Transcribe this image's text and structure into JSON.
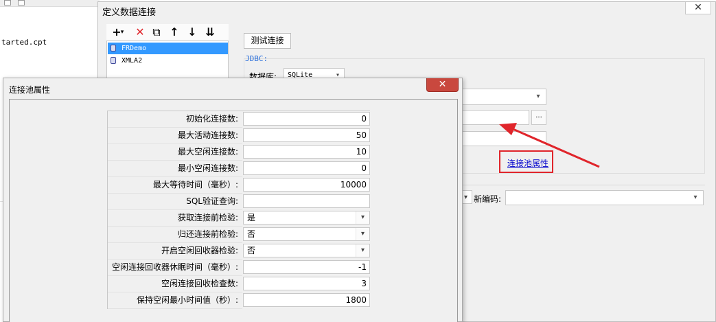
{
  "background": {
    "file_name": "tarted.cpt"
  },
  "main_dialog": {
    "title": "定义数据连接",
    "close_symbol": "✕",
    "toolbar": {
      "add": "+",
      "add_dropdown": "▾",
      "delete": "✕",
      "copy": "⧉",
      "up": "↑",
      "down": "↓",
      "sort": "⇊"
    },
    "connections": [
      {
        "name": "FRDemo",
        "selected": true
      },
      {
        "name": "XMLA2",
        "selected": false
      }
    ],
    "test_button": "测试连接",
    "jdbc_label": "JDBC:",
    "database_label": "数据库:",
    "database_value": "SQLite",
    "pool_link": "连接池属性",
    "browse_button": "...",
    "new_encoding_label": "新编码:",
    "new_encoding_value": "",
    "annotation_color": "#e0252b"
  },
  "pool_dialog": {
    "title": "连接池属性",
    "close_symbol": "✕",
    "rows": [
      {
        "label": "初始化连接数:",
        "value": "0",
        "type": "text"
      },
      {
        "label": "最大活动连接数:",
        "value": "50",
        "type": "text"
      },
      {
        "label": "最大空闲连接数:",
        "value": "10",
        "type": "text"
      },
      {
        "label": "最小空闲连接数:",
        "value": "0",
        "type": "text"
      },
      {
        "label": "最大等待时间（毫秒）:",
        "value": "10000",
        "type": "text"
      },
      {
        "label": "SQL验证查询:",
        "value": "",
        "type": "text"
      },
      {
        "label": "获取连接前检验:",
        "value": "是",
        "type": "select"
      },
      {
        "label": "归还连接前检验:",
        "value": "否",
        "type": "select"
      },
      {
        "label": "开启空闲回收器检验:",
        "value": "否",
        "type": "select"
      },
      {
        "label": "空闲连接回收器休眠时间（毫秒）:",
        "value": "-1",
        "type": "text"
      },
      {
        "label": "空闲连接回收检查数:",
        "value": "3",
        "type": "text"
      },
      {
        "label": "保持空闲最小时间值（秒）:",
        "value": "1800",
        "type": "text"
      }
    ]
  }
}
